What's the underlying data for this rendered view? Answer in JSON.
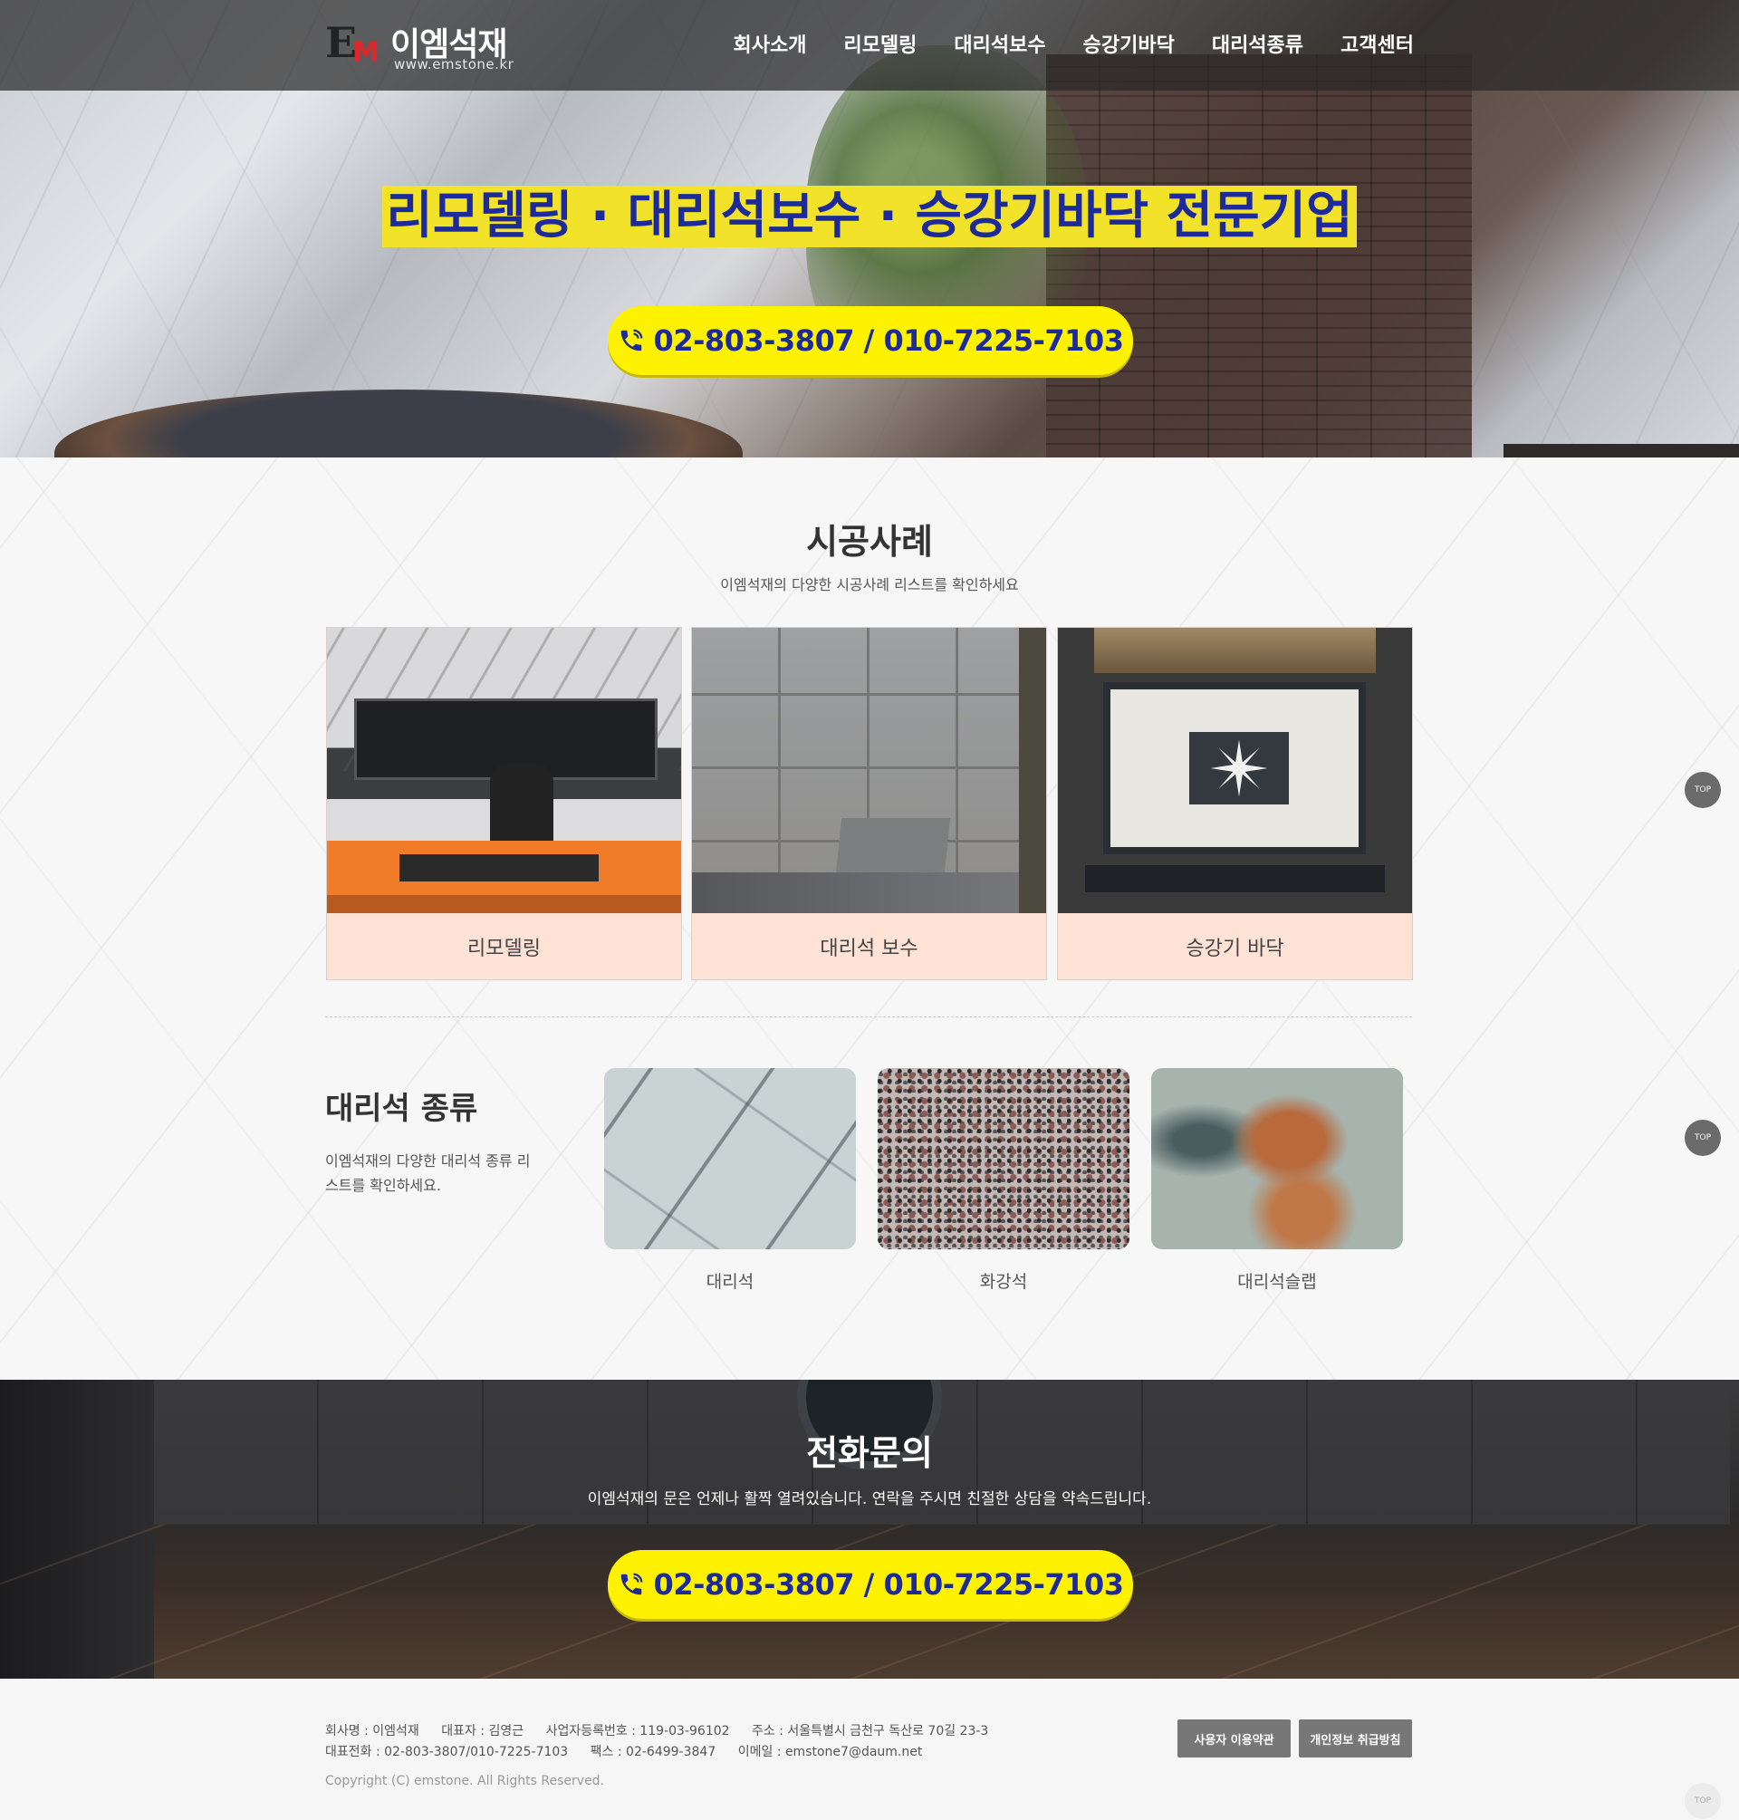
{
  "header": {
    "logo_mark_e": "E",
    "logo_mark_m": "M",
    "logo_name": "이엠석재",
    "logo_url": "www.emstone.kr",
    "nav": [
      "회사소개",
      "리모델링",
      "대리석보수",
      "승강기바닥",
      "대리석종류",
      "고객센터"
    ]
  },
  "hero": {
    "headline": "리모델링 · 대리석보수 · 승강기바닥  전문기업",
    "phone": "02-803-3807 / 010-7225-7103"
  },
  "cases": {
    "title": "시공사례",
    "subtitle": "이엠석재의 다양한 시공사례 리스트를 확인하세요",
    "items": [
      {
        "label": "리모델링"
      },
      {
        "label": "대리석 보수"
      },
      {
        "label": "승강기 바닥"
      }
    ]
  },
  "stones": {
    "title": "대리석 종류",
    "desc": "이엠석재의 다양한 대리석 종류 리스트를 확인하세요.",
    "items": [
      {
        "label": "대리석"
      },
      {
        "label": "화강석"
      },
      {
        "label": "대리석슬랩"
      }
    ]
  },
  "contact": {
    "title": "전화문의",
    "subtitle": "이엠석재의 문은 언제나 활짝 열려있습니다. 연락을 주시면 친절한 상담을 약속드립니다.",
    "phone": "02-803-3807 / 010-7225-7103"
  },
  "footer": {
    "company": "회사명 : 이엠석재",
    "ceo": "대표자 : 김영근",
    "bizno": "사업자등록번호 : 119-03-96102",
    "address": "주소 : 서울특별시 금천구 독산로 70길 23-3",
    "tel": "대표전화 : 02-803-3807/010-7225-7103",
    "fax": "팩스 : 02-6499-3847",
    "email": "이메일 : emstone7@daum.net",
    "copyright": "Copyright (C) emstone. All Rights Reserved.",
    "terms_button": "사용자 이용약관",
    "privacy_button": "개인정보 취급방침"
  },
  "top_button": "TOP",
  "colors": {
    "accent_yellow": "#fff200",
    "headline_blue": "#1d2b9a",
    "card_caption_bg": "#fde2d5"
  }
}
